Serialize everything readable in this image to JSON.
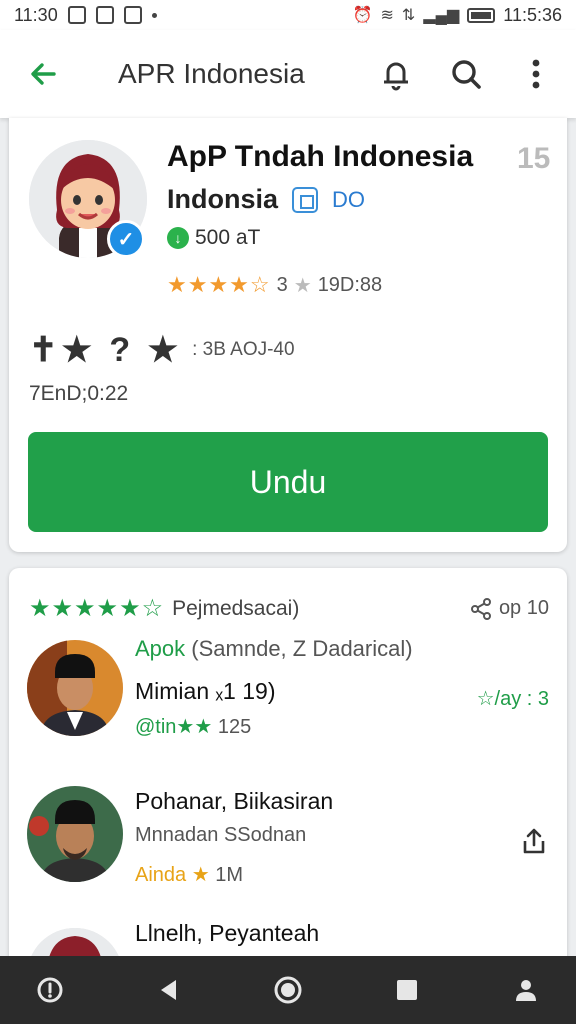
{
  "status_bar": {
    "time": "11:30",
    "right_text": "11:5:36"
  },
  "app_bar": {
    "title": "APR Indonesia",
    "icons": [
      "back-arrow-icon",
      "bell-icon",
      "search-icon",
      "more-vert-icon"
    ]
  },
  "app": {
    "name": "ApP Tndah Indonesia",
    "badge_number": "15",
    "subname": "Indonsia",
    "tag": "DO",
    "downloads": "500 aT",
    "rating_stars": "★★★★☆",
    "rating_value": "3",
    "rating_count": "19D:88",
    "meta_glyphs": "✝★ ? ★",
    "meta_text": ": 3B AOJ-40",
    "meta_time": "7EnD;0:22",
    "install_label": "Undu",
    "accent_color": "#21a04a"
  },
  "reviews_section": {
    "stars": "★★★★★☆",
    "label": "Pejmedsacai)",
    "count": "op 10",
    "items": [
      {
        "sub_green": "Apok",
        "sub_grey": "(Samnde, Z Dadarical)",
        "name": "Mimian ₓ1 19)",
        "meta_prefix": "@tin★★",
        "meta_value": "125",
        "right": "☆/ay : 3"
      },
      {
        "name": "Pohanar, Biikasiran",
        "sub": "Mnnadan SSodnan",
        "meta_prefix": "Ainda ★",
        "meta_value": "1M"
      },
      {
        "name": "Llnelh, Peyanteah"
      }
    ]
  },
  "nav_bar": {
    "icons": [
      "info-icon",
      "back-triangle-icon",
      "home-circle-icon",
      "recents-square-icon",
      "account-icon"
    ]
  }
}
